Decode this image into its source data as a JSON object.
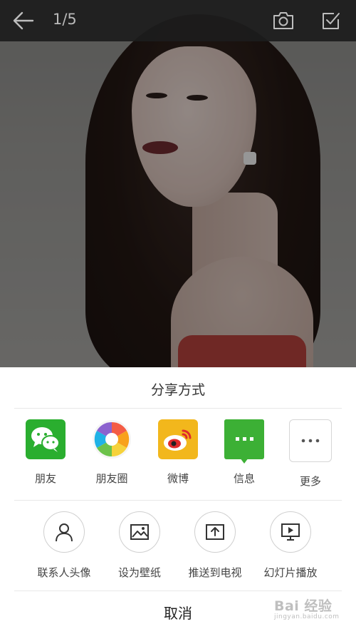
{
  "viewer": {
    "page_indicator": "1/5",
    "icons": {
      "back": "arrow-left-icon",
      "camera": "camera-icon",
      "select": "checkbox-icon"
    }
  },
  "share_sheet": {
    "title": "分享方式",
    "share_targets": [
      {
        "label": "朋友",
        "icon": "wechat-icon",
        "color": "#2aae2f"
      },
      {
        "label": "朋友圈",
        "icon": "moments-icon",
        "color": "#ffffff"
      },
      {
        "label": "微博",
        "icon": "weibo-icon",
        "color": "#f2b71c"
      },
      {
        "label": "信息",
        "icon": "message-icon",
        "color": "#3cb035"
      },
      {
        "label": "更多",
        "icon": "more-icon",
        "color": "#ffffff"
      }
    ],
    "actions": [
      {
        "label": "联系人头像",
        "icon": "person-icon"
      },
      {
        "label": "设为壁纸",
        "icon": "image-icon"
      },
      {
        "label": "推送到电视",
        "icon": "cast-icon"
      },
      {
        "label": "幻灯片播放",
        "icon": "slideshow-icon"
      }
    ],
    "cancel_label": "取消"
  },
  "watermark": {
    "text": "Bai 经验",
    "subtext": "jingyan.baidu.com"
  }
}
